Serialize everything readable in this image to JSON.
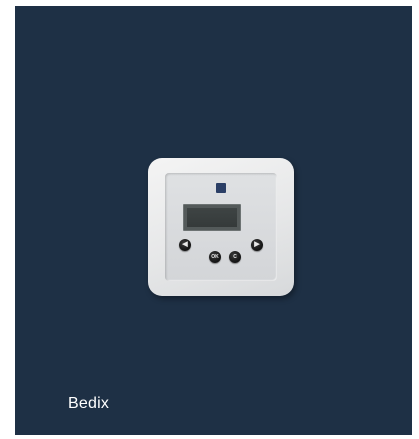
{
  "caption": "Bedix",
  "device": {
    "ok_label": "OK",
    "c_label": "C",
    "left_icon": "chevron-left-icon",
    "right_icon": "chevron-right-icon"
  },
  "colors": {
    "background": "#1e3045",
    "device_body": "#e6e7e8",
    "button": "#121212"
  }
}
